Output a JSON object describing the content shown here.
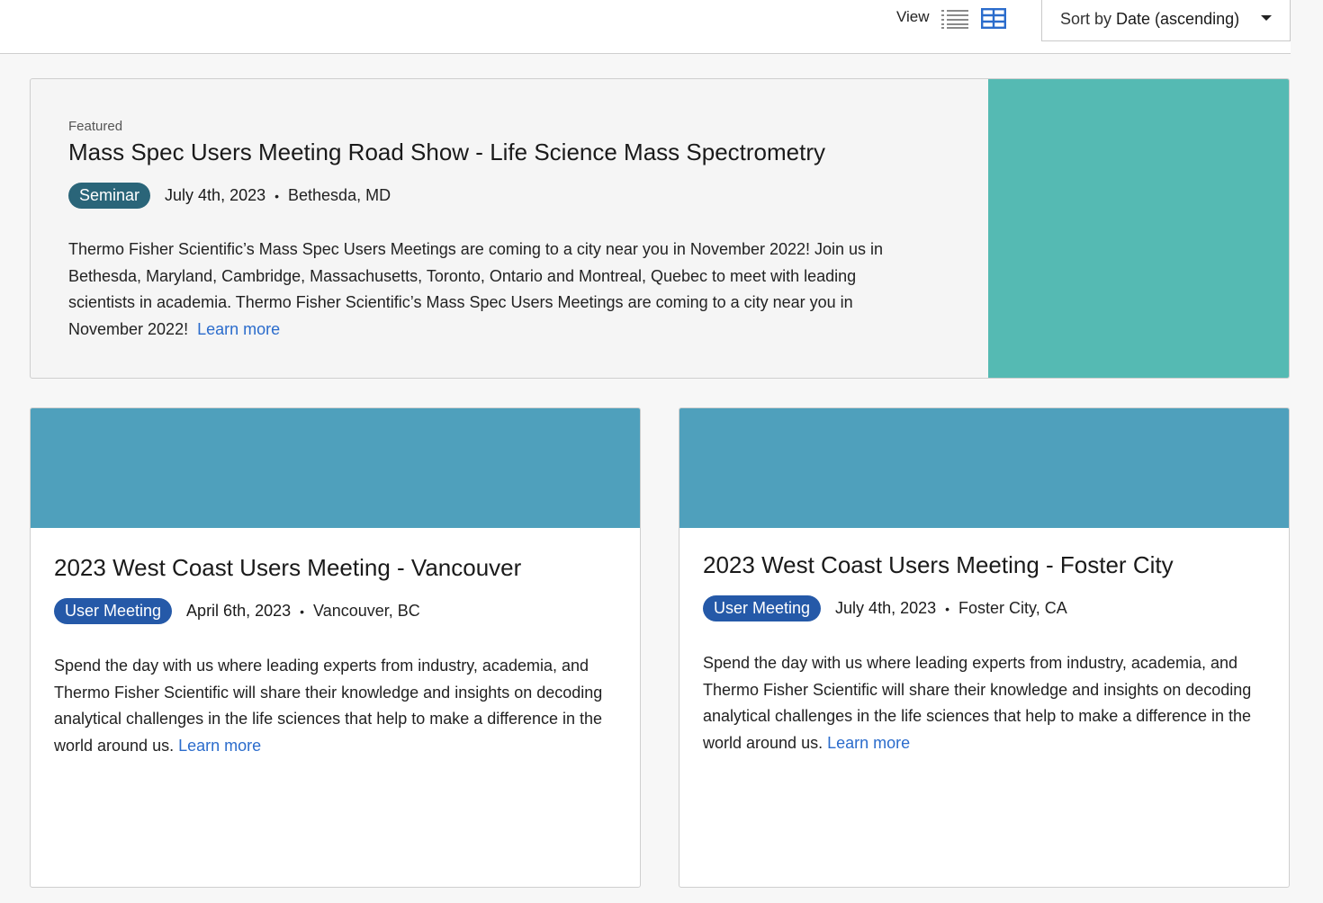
{
  "toolbar": {
    "view_label": "View",
    "sort_prefix": "Sort by",
    "sort_value": "Date (ascending)",
    "active_view": "grid",
    "accent_color": "#2b6ccc"
  },
  "featured": {
    "eyebrow": "Featured",
    "title": "Mass Spec Users Meeting Road Show - Life Science Mass Spectrometry",
    "badge": "Seminar",
    "date": "July 4th, 2023",
    "separator": "•",
    "location": "Bethesda, MD",
    "description": "Thermo Fisher Scientific’s Mass Spec Users Meetings are coming to a city near you in November 2022! Join us in Bethesda, Maryland, Cambridge, Massachusetts, Toronto, Ontario and Montreal, Quebec to meet with leading scientists in academia. Thermo Fisher Scientific’s Mass Spec Users Meetings are coming to a city near you in November 2022!",
    "learn_more": "Learn more",
    "image_color": "#55bab3"
  },
  "cards": [
    {
      "title": "2023 West Coast Users Meeting - Vancouver",
      "badge": "User Meeting",
      "date": "April 6th, 2023",
      "separator": "•",
      "location": "Vancouver, BC",
      "description": "Spend the day with us where leading experts from industry, academia, and Thermo Fisher Scientific will share their knowledge and insights on decoding analytical challenges in the life sciences that help to make a difference in the world around us.",
      "learn_more": "Learn more",
      "image_color": "#4fa0bc"
    },
    {
      "title": "2023 West Coast Users Meeting - Foster City",
      "badge": "User Meeting",
      "date": "July 4th, 2023",
      "separator": "•",
      "location": "Foster City, CA",
      "description": "Spend the day with us where leading experts from industry, academia, and Thermo Fisher Scientific will share their knowledge and insights on decoding analytical challenges in the life sciences that help to make a difference in the world around us.",
      "learn_more": "Learn more",
      "image_color": "#4fa0bc"
    }
  ]
}
